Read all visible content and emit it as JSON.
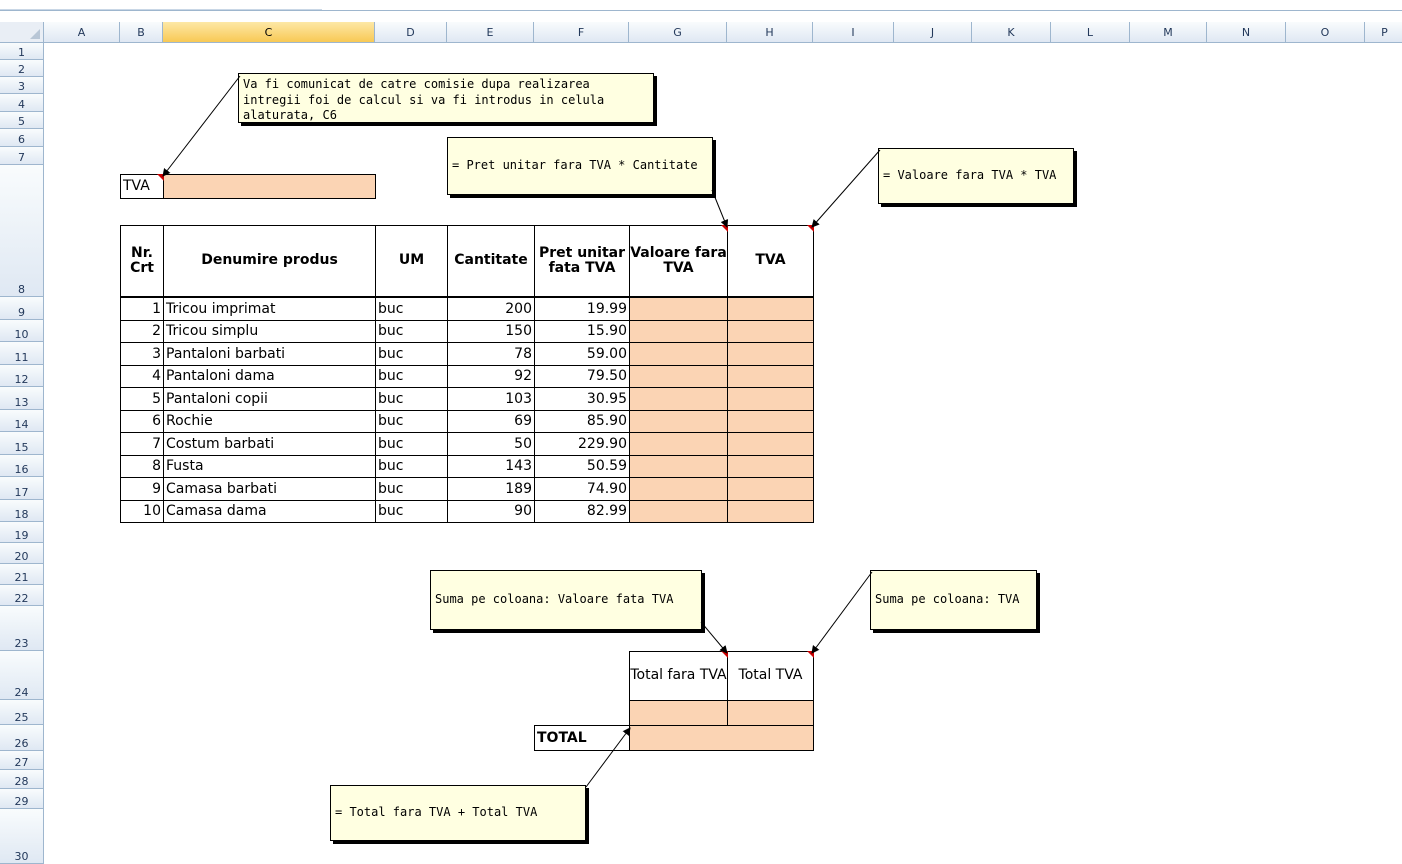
{
  "columns": [
    "A",
    "B",
    "C",
    "D",
    "E",
    "F",
    "G",
    "H",
    "I",
    "J",
    "K",
    "L",
    "M",
    "N",
    "O",
    "P"
  ],
  "active_column": "C",
  "rows": [
    "1",
    "2",
    "3",
    "4",
    "5",
    "6",
    "7",
    "8",
    "9",
    "10",
    "11",
    "12",
    "13",
    "14",
    "15",
    "16",
    "17",
    "18",
    "19",
    "20",
    "21",
    "22",
    "23",
    "24",
    "25",
    "26",
    "27",
    "28",
    "29",
    "30"
  ],
  "tva_label": "TVA",
  "table": {
    "headers": [
      "Nr. Crt",
      "Denumire produs",
      "UM",
      "Cantitate",
      "Pret unitar fata TVA",
      "Valoare fara TVA",
      "TVA"
    ],
    "rows": [
      {
        "nr": "1",
        "produs": "Tricou imprimat",
        "um": "buc",
        "cantitate": "200",
        "pret": "19.99"
      },
      {
        "nr": "2",
        "produs": "Tricou simplu",
        "um": "buc",
        "cantitate": "150",
        "pret": "15.90"
      },
      {
        "nr": "3",
        "produs": "Pantaloni barbati",
        "um": "buc",
        "cantitate": "78",
        "pret": "59.00"
      },
      {
        "nr": "4",
        "produs": "Pantaloni dama",
        "um": "buc",
        "cantitate": "92",
        "pret": "79.50"
      },
      {
        "nr": "5",
        "produs": "Pantaloni copii",
        "um": "buc",
        "cantitate": "103",
        "pret": "30.95"
      },
      {
        "nr": "6",
        "produs": "Rochie",
        "um": "buc",
        "cantitate": "69",
        "pret": "85.90"
      },
      {
        "nr": "7",
        "produs": "Costum barbati",
        "um": "buc",
        "cantitate": "50",
        "pret": "229.90"
      },
      {
        "nr": "8",
        "produs": "Fusta",
        "um": "buc",
        "cantitate": "143",
        "pret": "50.59"
      },
      {
        "nr": "9",
        "produs": "Camasa barbati",
        "um": "buc",
        "cantitate": "189",
        "pret": "74.90"
      },
      {
        "nr": "10",
        "produs": "Camasa dama",
        "um": "buc",
        "cantitate": "90",
        "pret": "82.99"
      }
    ]
  },
  "totals": {
    "total_fara_tva": "Total fara TVA",
    "total_tva": "Total TVA",
    "total_label": "TOTAL"
  },
  "comments": {
    "tva_note": "Va fi comunicat de catre comisie dupa realizarea intregii foi de calcul si va fi introdus in celula alaturata, C6",
    "valoare_note": "= Pret unitar fara TVA * Cantitate",
    "tva_formula_note": "= Valoare fara TVA * TVA",
    "suma_valoare_note": "Suma pe coloana: Valoare fata TVA",
    "suma_tva_note": "Suma pe coloana: TVA",
    "total_note": "= Total fara TVA + Total TVA"
  },
  "colors": {
    "fill": "#fbd4b4",
    "note_bg": "#ffffe1",
    "comment_marker": "#cc0000",
    "header_active": "#f8c955"
  }
}
